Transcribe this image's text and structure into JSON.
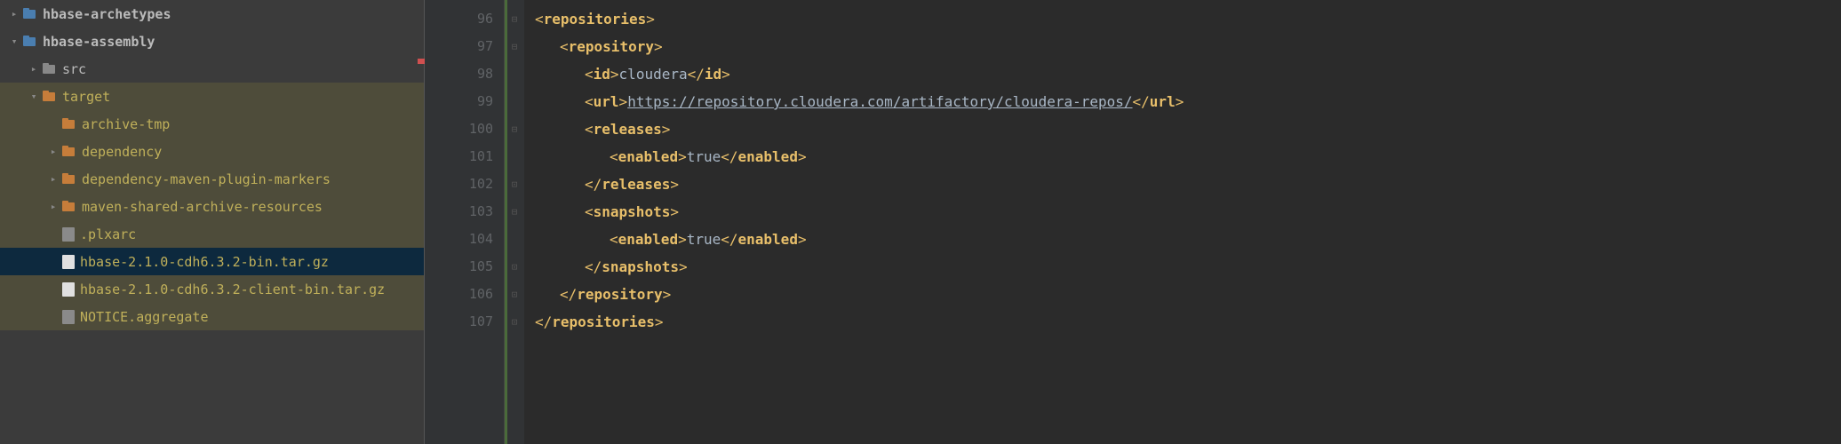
{
  "tree": [
    {
      "depth": 0,
      "arrow": "right",
      "icon": "module",
      "label": "hbase-archetypes",
      "cls": "white bold",
      "dim": false,
      "sel": false
    },
    {
      "depth": 0,
      "arrow": "down",
      "icon": "module",
      "label": "hbase-assembly",
      "cls": "white bold",
      "dim": false,
      "sel": false
    },
    {
      "depth": 1,
      "arrow": "right",
      "icon": "folder-grey",
      "label": "src",
      "cls": "white",
      "dim": false,
      "sel": false
    },
    {
      "depth": 1,
      "arrow": "down",
      "icon": "folder-orange",
      "label": "target",
      "cls": "yellow",
      "dim": true,
      "sel": false
    },
    {
      "depth": 2,
      "arrow": "",
      "icon": "folder-orange",
      "label": "archive-tmp",
      "cls": "yellow",
      "dim": true,
      "sel": false
    },
    {
      "depth": 2,
      "arrow": "right",
      "icon": "folder-orange",
      "label": "dependency",
      "cls": "yellow",
      "dim": true,
      "sel": false
    },
    {
      "depth": 2,
      "arrow": "right",
      "icon": "folder-orange",
      "label": "dependency-maven-plugin-markers",
      "cls": "yellow",
      "dim": true,
      "sel": false
    },
    {
      "depth": 2,
      "arrow": "right",
      "icon": "folder-orange",
      "label": "maven-shared-archive-resources",
      "cls": "yellow",
      "dim": true,
      "sel": false
    },
    {
      "depth": 2,
      "arrow": "",
      "icon": "file-txt",
      "label": ".plxarc",
      "cls": "yellow",
      "dim": true,
      "sel": false
    },
    {
      "depth": 2,
      "arrow": "",
      "icon": "file-archive",
      "label": "hbase-2.1.0-cdh6.3.2-bin.tar.gz",
      "cls": "yellow",
      "dim": false,
      "sel": true
    },
    {
      "depth": 2,
      "arrow": "",
      "icon": "file-archive",
      "label": "hbase-2.1.0-cdh6.3.2-client-bin.tar.gz",
      "cls": "yellow",
      "dim": true,
      "sel": false
    },
    {
      "depth": 2,
      "arrow": "",
      "icon": "file-txt",
      "label": "NOTICE.aggregate",
      "cls": "yellow",
      "dim": true,
      "sel": false
    }
  ],
  "lineStart": 96,
  "code": {
    "lines": [
      {
        "ind": 0,
        "parts": [
          {
            "t": "<",
            "c": "tag-bracket"
          },
          {
            "t": "repositories",
            "c": "tag-name"
          },
          {
            "t": ">",
            "c": "tag-bracket"
          }
        ],
        "fold": "open-down"
      },
      {
        "ind": 1,
        "parts": [
          {
            "t": "<",
            "c": "tag-bracket"
          },
          {
            "t": "repository",
            "c": "tag-name"
          },
          {
            "t": ">",
            "c": "tag-bracket"
          }
        ],
        "fold": "open-down"
      },
      {
        "ind": 2,
        "parts": [
          {
            "t": "<",
            "c": "tag-bracket"
          },
          {
            "t": "id",
            "c": "tag-name"
          },
          {
            "t": ">",
            "c": "tag-bracket"
          },
          {
            "t": "cloudera",
            "c": "text-val"
          },
          {
            "t": "</",
            "c": "tag-bracket"
          },
          {
            "t": "id",
            "c": "tag-name"
          },
          {
            "t": ">",
            "c": "tag-bracket"
          }
        ],
        "fold": ""
      },
      {
        "ind": 2,
        "parts": [
          {
            "t": "<",
            "c": "tag-bracket"
          },
          {
            "t": "url",
            "c": "tag-name"
          },
          {
            "t": ">",
            "c": "tag-bracket"
          },
          {
            "t": "https://repository.cloudera.com/artifactory/cloudera-repos/",
            "c": "link"
          },
          {
            "t": "</",
            "c": "tag-bracket"
          },
          {
            "t": "url",
            "c": "tag-name"
          },
          {
            "t": ">",
            "c": "tag-bracket"
          }
        ],
        "fold": ""
      },
      {
        "ind": 2,
        "parts": [
          {
            "t": "<",
            "c": "tag-bracket"
          },
          {
            "t": "releases",
            "c": "tag-name"
          },
          {
            "t": ">",
            "c": "tag-bracket"
          }
        ],
        "fold": "open-down"
      },
      {
        "ind": 3,
        "parts": [
          {
            "t": "<",
            "c": "tag-bracket"
          },
          {
            "t": "enabled",
            "c": "tag-name"
          },
          {
            "t": ">",
            "c": "tag-bracket"
          },
          {
            "t": "true",
            "c": "text-val"
          },
          {
            "t": "</",
            "c": "tag-bracket"
          },
          {
            "t": "enabled",
            "c": "tag-name"
          },
          {
            "t": ">",
            "c": "tag-bracket"
          }
        ],
        "fold": ""
      },
      {
        "ind": 2,
        "parts": [
          {
            "t": "</",
            "c": "tag-bracket"
          },
          {
            "t": "releases",
            "c": "tag-name"
          },
          {
            "t": ">",
            "c": "tag-bracket"
          }
        ],
        "fold": "close"
      },
      {
        "ind": 2,
        "parts": [
          {
            "t": "<",
            "c": "tag-bracket"
          },
          {
            "t": "snapshots",
            "c": "tag-name"
          },
          {
            "t": ">",
            "c": "tag-bracket"
          }
        ],
        "fold": "open-down"
      },
      {
        "ind": 3,
        "parts": [
          {
            "t": "<",
            "c": "tag-bracket"
          },
          {
            "t": "enabled",
            "c": "tag-name"
          },
          {
            "t": ">",
            "c": "tag-bracket"
          },
          {
            "t": "true",
            "c": "text-val"
          },
          {
            "t": "</",
            "c": "tag-bracket"
          },
          {
            "t": "enabled",
            "c": "tag-name"
          },
          {
            "t": ">",
            "c": "tag-bracket"
          }
        ],
        "fold": ""
      },
      {
        "ind": 2,
        "parts": [
          {
            "t": "</",
            "c": "tag-bracket"
          },
          {
            "t": "snapshots",
            "c": "tag-name"
          },
          {
            "t": ">",
            "c": "tag-bracket"
          }
        ],
        "fold": "close"
      },
      {
        "ind": 1,
        "parts": [
          {
            "t": "</",
            "c": "tag-bracket"
          },
          {
            "t": "repository",
            "c": "tag-name"
          },
          {
            "t": ">",
            "c": "tag-bracket"
          }
        ],
        "fold": "close"
      },
      {
        "ind": 0,
        "parts": [
          {
            "t": "</",
            "c": "tag-bracket"
          },
          {
            "t": "repositories",
            "c": "tag-name"
          },
          {
            "t": ">",
            "c": "tag-bracket"
          }
        ],
        "fold": "close"
      }
    ]
  }
}
